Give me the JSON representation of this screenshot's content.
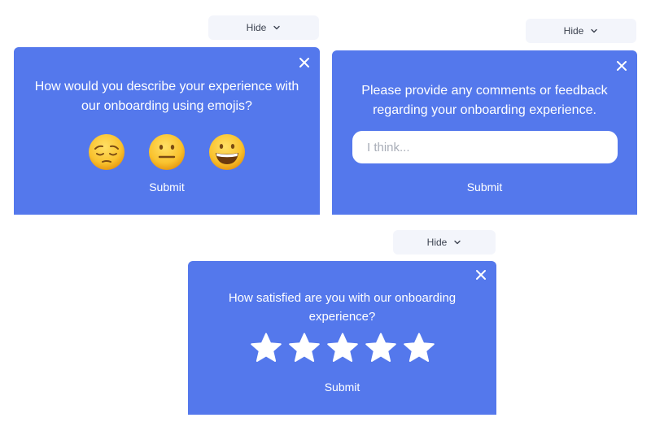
{
  "colors": {
    "widget_bg": "#5478ec",
    "hide_bg": "#f3f5fb",
    "text_on_widget": "#ffffff"
  },
  "widgets": [
    {
      "type": "emoji-rating",
      "hide_label": "Hide",
      "question": "How would you describe your experience with our onboarding using emojis?",
      "options": [
        {
          "name": "pensive-face",
          "glyph": "😔"
        },
        {
          "name": "neutral-face",
          "glyph": "😐"
        },
        {
          "name": "grinning-face",
          "glyph": "😀"
        }
      ],
      "submit_label": "Submit"
    },
    {
      "type": "text-feedback",
      "hide_label": "Hide",
      "question": "Please provide any comments or feedback regarding your onboarding experience.",
      "input_value": "",
      "input_placeholder": "I think...",
      "submit_label": "Submit"
    },
    {
      "type": "star-rating",
      "hide_label": "Hide",
      "question": "How satisfied are you with our onboarding experience?",
      "star_count": 5,
      "selected_stars": 0,
      "submit_label": "Submit"
    }
  ]
}
